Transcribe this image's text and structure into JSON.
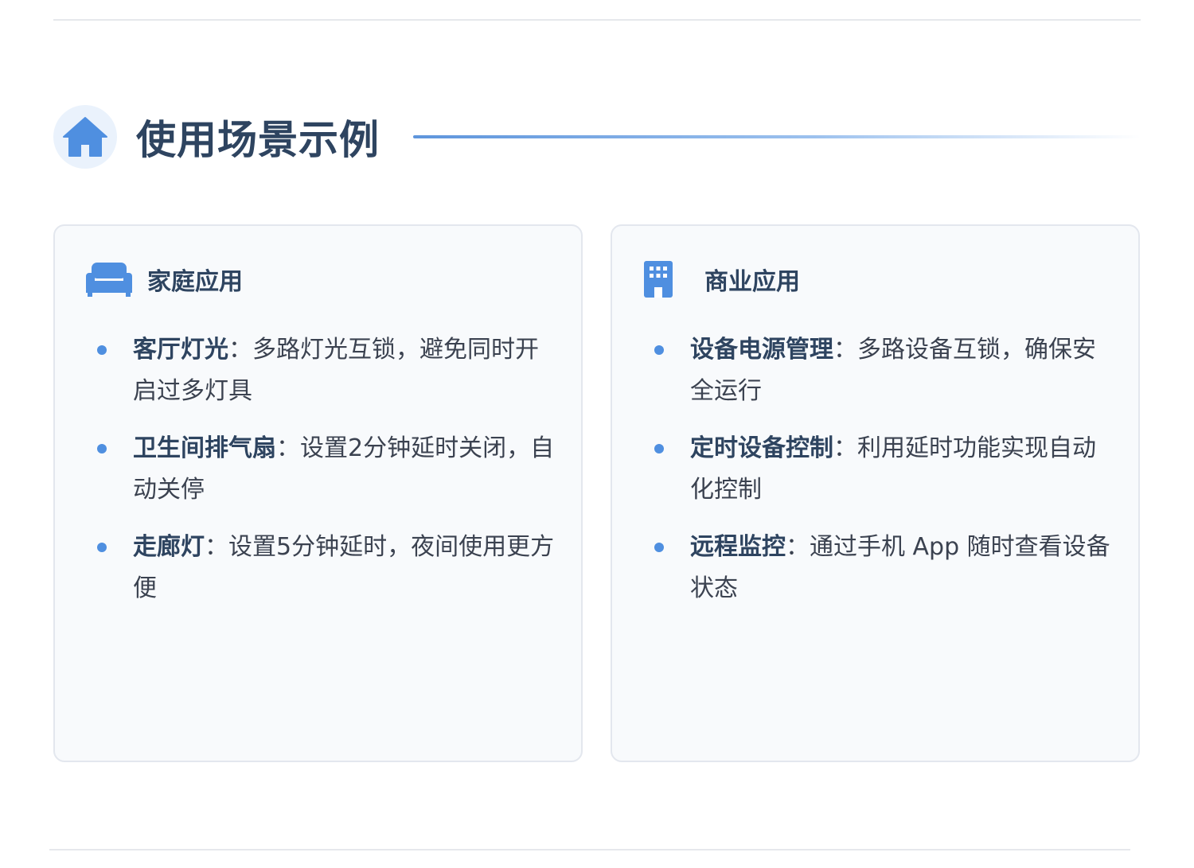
{
  "section": {
    "title": "使用场景示例",
    "icon": "home-icon"
  },
  "cards": [
    {
      "title": "家庭应用",
      "icon": "sofa-icon",
      "items": [
        {
          "label": "客厅灯光",
          "separator": "：",
          "text": "多路灯光互锁，避免同时开启过多灯具"
        },
        {
          "label": "卫生间排气扇",
          "separator": "：",
          "text": "设置2分钟延时关闭，自动关停"
        },
        {
          "label": "走廊灯",
          "separator": "：",
          "text": "设置5分钟延时，夜间使用更方便"
        }
      ]
    },
    {
      "title": "商业应用",
      "icon": "building-icon",
      "items": [
        {
          "label": "设备电源管理",
          "separator": "：",
          "text": "多路设备互锁，确保安全运行"
        },
        {
          "label": "定时设备控制",
          "separator": "：",
          "text": "利用延时功能实现自动化控制"
        },
        {
          "label": "远程监控",
          "separator": "：",
          "text": "通过手机 App 随时查看设备状态"
        }
      ]
    }
  ],
  "colors": {
    "accent": "#4f8fe0",
    "title": "#2e4460",
    "body": "#3b4250",
    "card_bg": "#f8fafc",
    "card_border": "#e3e7ee"
  }
}
